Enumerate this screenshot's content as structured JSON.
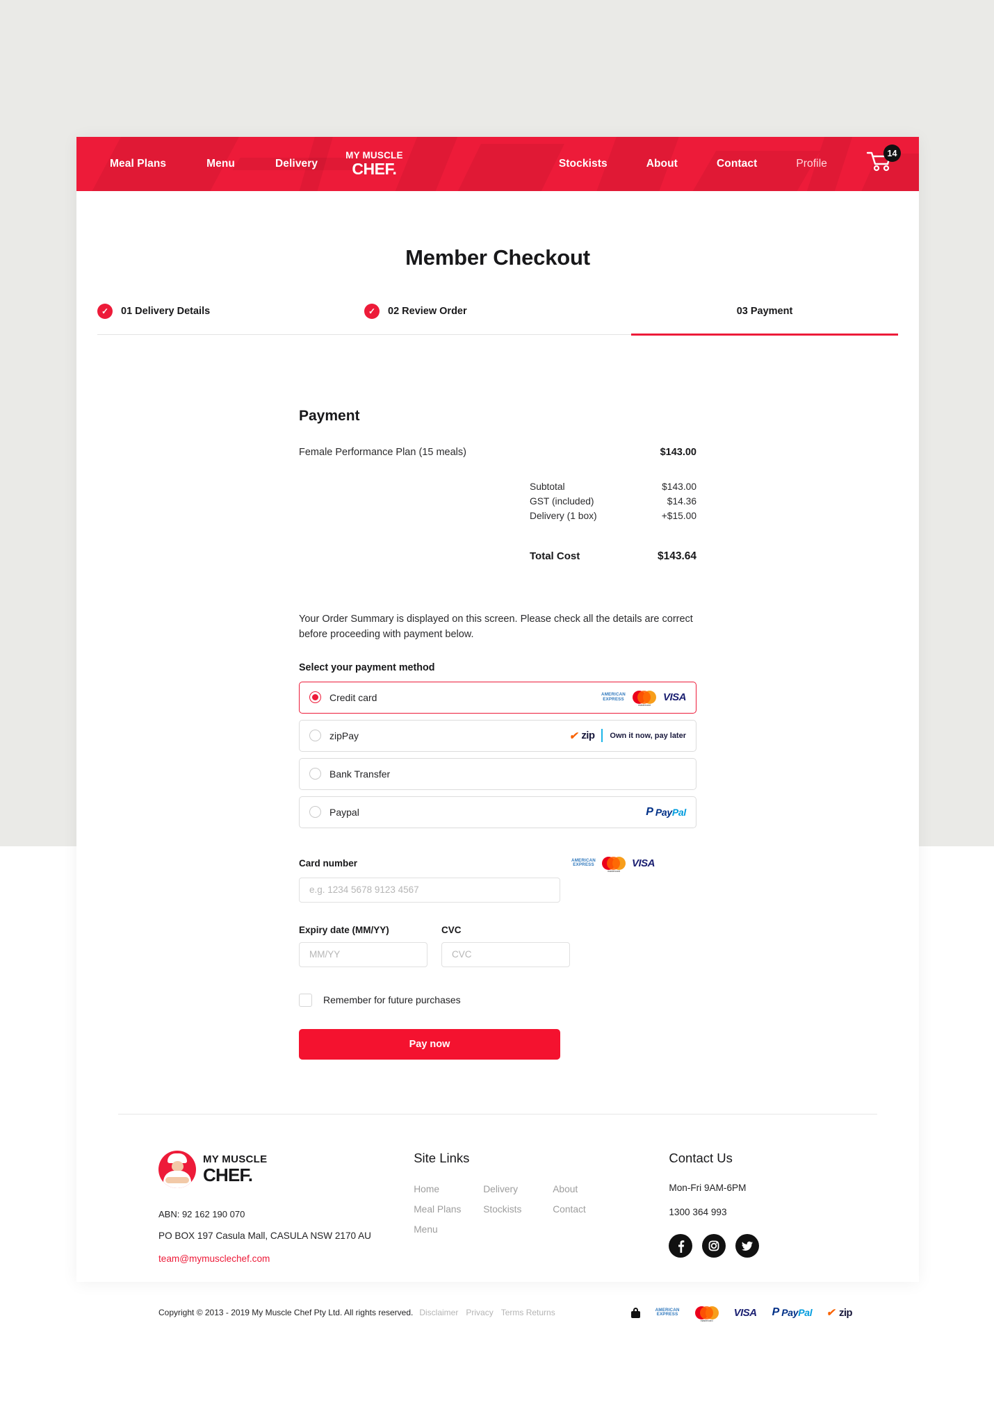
{
  "nav": {
    "left_links": [
      {
        "label": "Meal Plans",
        "name": "nav-meal-plans"
      },
      {
        "label": "Menu",
        "name": "nav-menu"
      },
      {
        "label": "Delivery",
        "name": "nav-delivery"
      }
    ],
    "logo": {
      "line1": "MY MUSCLE",
      "line2": "CHEF."
    },
    "right_links": [
      {
        "label": "Stockists",
        "name": "nav-stockists"
      },
      {
        "label": "About",
        "name": "nav-about"
      },
      {
        "label": "Contact",
        "name": "nav-contact"
      }
    ],
    "profile_label": "Profile",
    "cart_count": "14",
    "background_color": "#ED1B39"
  },
  "page": {
    "title": "Member Checkout"
  },
  "steps": [
    {
      "label": "01 Delivery Details",
      "state": "complete",
      "check": "✓"
    },
    {
      "label": "02 Review Order",
      "state": "complete",
      "check": "✓"
    },
    {
      "label": "03 Payment",
      "state": "active",
      "check": ""
    }
  ],
  "payment": {
    "heading": "Payment",
    "line_item": {
      "name": "Female Performance Plan (15 meals)",
      "amount": "$143.00"
    },
    "totals": [
      {
        "label": "Subtotal",
        "value": "$143.00"
      },
      {
        "label": "GST (included)",
        "value": "$14.36"
      },
      {
        "label": "Delivery (1 box)",
        "value": "+$15.00"
      }
    ],
    "grand_total": {
      "label": "Total Cost",
      "value": "$143.64"
    },
    "summary_note": "Your Order Summary is displayed on this screen. Please check all the details are correct before proceeding with payment below.",
    "method_title": "Select your payment method",
    "methods": [
      {
        "label": "Credit card",
        "selected": true,
        "logos": [
          "amex",
          "mastercard",
          "visa"
        ]
      },
      {
        "label": "zipPay",
        "selected": false,
        "logos": [
          "zip"
        ],
        "tagline": "Own it now, pay later"
      },
      {
        "label": "Bank Transfer",
        "selected": false,
        "logos": []
      },
      {
        "label": "Paypal",
        "selected": false,
        "logos": [
          "paypal"
        ]
      }
    ],
    "card_number": {
      "label": "Card number",
      "placeholder": "e.g. 1234 5678 9123 4567",
      "value": ""
    },
    "expiry": {
      "label": "Expiry date (MM/YY)",
      "placeholder": "MM/YY",
      "value": ""
    },
    "cvc": {
      "label": "CVC",
      "placeholder": "CVC",
      "value": ""
    },
    "remember_label": "Remember for future purchases",
    "remember_checked": false,
    "pay_button": "Pay now",
    "accent_color": "#F4122F"
  },
  "footer": {
    "brand": {
      "line1": "MY MUSCLE",
      "line2": "CHEF."
    },
    "abn": "ABN: 92 162 190 070",
    "address": "PO BOX 197 Casula Mall, CASULA NSW 2170 AU",
    "email": "team@mymusclechef.com",
    "site_links_heading": "Site Links",
    "site_links": [
      "Home",
      "Delivery",
      "About",
      "Meal Plans",
      "Stockists",
      "Contact",
      "Menu"
    ],
    "contact_heading": "Contact Us",
    "hours": "Mon-Fri 9AM-6PM",
    "phone": "1300 364 993",
    "socials": [
      {
        "name": "facebook-icon",
        "glyph": "f"
      },
      {
        "name": "instagram-icon",
        "glyph": "◎"
      },
      {
        "name": "twitter-icon",
        "glyph": "🐦"
      }
    ],
    "copyright": "Copyright © 2013 - 2019 My Muscle Chef Pty Ltd. All rights reserved.",
    "legal_links": [
      "Disclaimer",
      "Privacy",
      "Terms Returns"
    ],
    "payment_icons": [
      "lock",
      "amex",
      "mastercard",
      "visa",
      "paypal",
      "zip"
    ],
    "amex_line1": "AMERICAN",
    "amex_line2": "EXPRESS",
    "mc_word": "mastercard",
    "visa_word": "VISA",
    "paypal_p": "P",
    "paypal_pay": "Pay",
    "paypal_pal": "Pal",
    "zip_word": "zip"
  }
}
